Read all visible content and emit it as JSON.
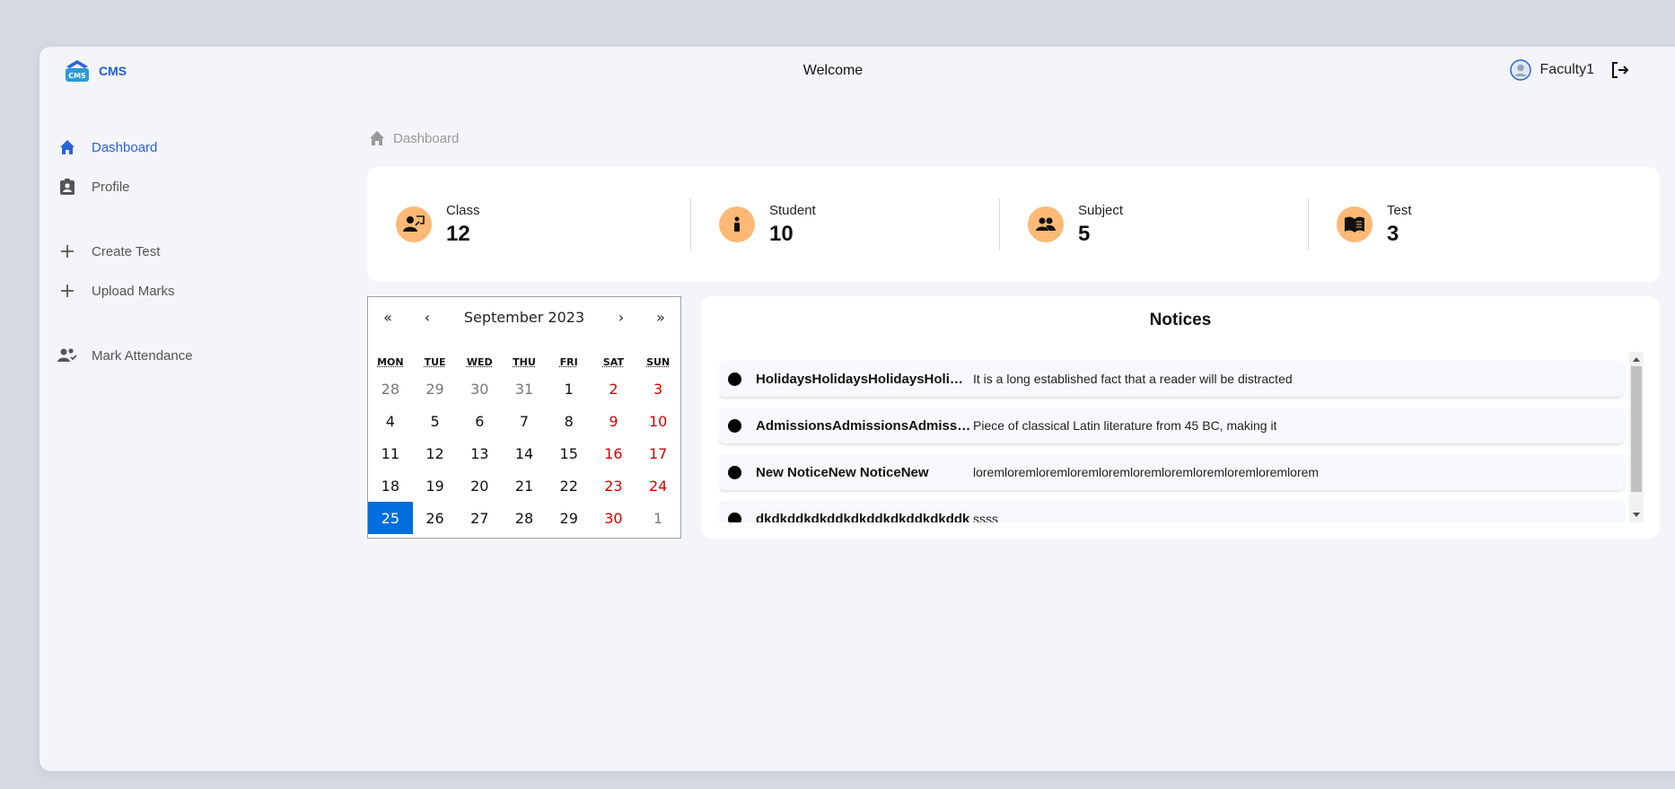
{
  "header": {
    "logo_text": "CMS",
    "logo_badge": "CMS",
    "title": "Welcome",
    "user_name": "Faculty1"
  },
  "sidebar": {
    "items": [
      {
        "label": "Dashboard",
        "icon": "home-icon",
        "active": true
      },
      {
        "label": "Profile",
        "icon": "id-badge-icon"
      },
      {
        "label": "Create Test",
        "icon": "plus-icon"
      },
      {
        "label": "Upload Marks",
        "icon": "plus-icon"
      },
      {
        "label": "Mark Attendance",
        "icon": "people-check-icon"
      }
    ]
  },
  "breadcrumb": {
    "label": "Dashboard"
  },
  "stats": [
    {
      "label": "Class",
      "value": "12",
      "icon": "teacher-icon"
    },
    {
      "label": "Student",
      "value": "10",
      "icon": "info-icon"
    },
    {
      "label": "Subject",
      "value": "5",
      "icon": "group-icon"
    },
    {
      "label": "Test",
      "value": "3",
      "icon": "book-icon"
    }
  ],
  "calendar": {
    "prev2": "«",
    "prev": "‹",
    "next": "›",
    "next2": "»",
    "month_label": "September 2023",
    "weekdays": [
      "MON",
      "TUE",
      "WED",
      "THU",
      "FRI",
      "SAT",
      "SUN"
    ],
    "days": [
      {
        "d": "28",
        "t": "other"
      },
      {
        "d": "29",
        "t": "other"
      },
      {
        "d": "30",
        "t": "other"
      },
      {
        "d": "31",
        "t": "other"
      },
      {
        "d": "1",
        "t": ""
      },
      {
        "d": "2",
        "t": "weekend"
      },
      {
        "d": "3",
        "t": "weekend"
      },
      {
        "d": "4",
        "t": ""
      },
      {
        "d": "5",
        "t": ""
      },
      {
        "d": "6",
        "t": ""
      },
      {
        "d": "7",
        "t": ""
      },
      {
        "d": "8",
        "t": ""
      },
      {
        "d": "9",
        "t": "weekend"
      },
      {
        "d": "10",
        "t": "weekend"
      },
      {
        "d": "11",
        "t": ""
      },
      {
        "d": "12",
        "t": ""
      },
      {
        "d": "13",
        "t": ""
      },
      {
        "d": "14",
        "t": ""
      },
      {
        "d": "15",
        "t": ""
      },
      {
        "d": "16",
        "t": "weekend"
      },
      {
        "d": "17",
        "t": "weekend"
      },
      {
        "d": "18",
        "t": ""
      },
      {
        "d": "19",
        "t": ""
      },
      {
        "d": "20",
        "t": ""
      },
      {
        "d": "21",
        "t": ""
      },
      {
        "d": "22",
        "t": ""
      },
      {
        "d": "23",
        "t": "weekend"
      },
      {
        "d": "24",
        "t": "weekend"
      },
      {
        "d": "25",
        "t": "selected"
      },
      {
        "d": "26",
        "t": ""
      },
      {
        "d": "27",
        "t": ""
      },
      {
        "d": "28",
        "t": ""
      },
      {
        "d": "29",
        "t": ""
      },
      {
        "d": "30",
        "t": "weekend"
      },
      {
        "d": "1",
        "t": "other"
      }
    ]
  },
  "notices": {
    "title": "Notices",
    "items": [
      {
        "title": "HolidaysHolidaysHolidaysHolidays",
        "body": "It is a long established fact that a reader will be distracted"
      },
      {
        "title": "AdmissionsAdmissionsAdmissions",
        "body": "Piece of classical Latin literature from 45 BC, making it"
      },
      {
        "title": "New NoticeNew NoticeNew",
        "body": "loremloremloremloremloremloremloremloremloremloremlorem"
      },
      {
        "title": "dkdkddkdkddkdkddkdkddkdkddk",
        "body": "ssss"
      }
    ]
  },
  "colors": {
    "accent": "#2a63d8",
    "stat_icon_bg": "#fdb975",
    "weekend": "#d10000",
    "selected_day": "#006edc"
  }
}
